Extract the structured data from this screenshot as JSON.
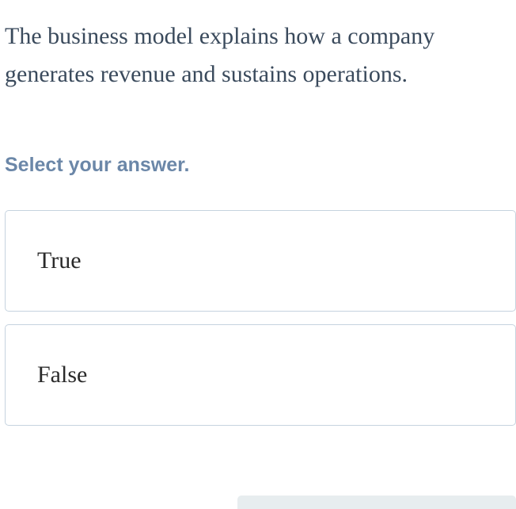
{
  "question": {
    "text": "The business model explains how a company generates revenue and sustains operations."
  },
  "instruction": "Select your answer.",
  "options": [
    {
      "label": "True"
    },
    {
      "label": "False"
    }
  ]
}
